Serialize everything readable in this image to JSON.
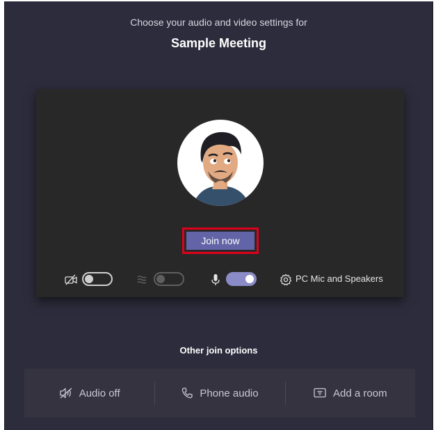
{
  "header": {
    "subtitle": "Choose your audio and video settings for",
    "meeting_title": "Sample Meeting"
  },
  "preview": {
    "join_label": "Join now",
    "camera_toggle": "off",
    "blur_toggle": "off",
    "mic_toggle": "on",
    "audio_device_label": "PC Mic and Speakers"
  },
  "other_options": {
    "heading": "Other join options",
    "items": [
      {
        "label": "Audio off",
        "icon": "speaker-off-icon"
      },
      {
        "label": "Phone audio",
        "icon": "phone-icon"
      },
      {
        "label": "Add a room",
        "icon": "cast-icon"
      }
    ]
  },
  "colors": {
    "background": "#2d2c3c",
    "preview_bg": "#292828",
    "accent": "#6264a7",
    "highlight": "#e0001b"
  }
}
